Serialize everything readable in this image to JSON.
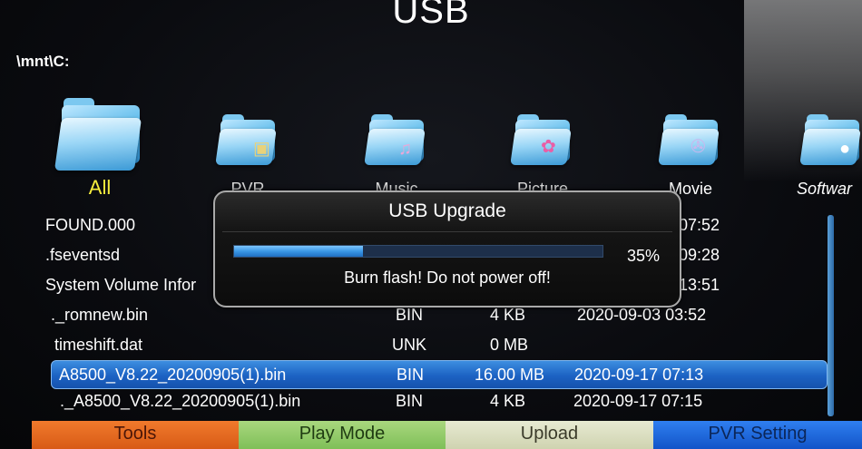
{
  "header": {
    "title": "USB",
    "path": "\\mnt\\C:"
  },
  "categories": [
    {
      "label": "All",
      "icon": "folder-icon",
      "active": true
    },
    {
      "label": "PVR",
      "icon": "pvr-folder-icon"
    },
    {
      "label": "Music",
      "icon": "music-folder-icon"
    },
    {
      "label": "Picture",
      "icon": "picture-folder-icon"
    },
    {
      "label": "Movie",
      "icon": "movie-folder-icon"
    },
    {
      "label": "Softwar",
      "icon": "software-folder-icon"
    }
  ],
  "files": [
    {
      "name": "FOUND.000",
      "type": "",
      "size": "",
      "date": "07:52"
    },
    {
      "name": ".fseventsd",
      "type": "",
      "size": "",
      "date": "09:28"
    },
    {
      "name": "System Volume Infor",
      "type": "",
      "size": "",
      "date": "13:51"
    },
    {
      "name": "._romnew.bin",
      "type": "BIN",
      "size": "4 KB",
      "date": "2020-09-03 03:52"
    },
    {
      "name": "timeshift.dat",
      "type": "UNK",
      "size": "0 MB",
      "date": ""
    },
    {
      "name": "A8500_V8.22_20200905(1).bin",
      "type": "BIN",
      "size": "16.00 MB",
      "date": "2020-09-17 07:13",
      "selected": true
    },
    {
      "name": "._A8500_V8.22_20200905(1).bin",
      "type": "BIN",
      "size": "4 KB",
      "date": "2020-09-17 07:15"
    }
  ],
  "dialog": {
    "title": "USB Upgrade",
    "progress": 0.35,
    "progress_label": "35%",
    "message": "Burn flash!  Do not power off!"
  },
  "bottom_bar": {
    "tools": "Tools",
    "play_mode": "Play Mode",
    "upload": "Upload",
    "pvr_setting": "PVR Setting"
  },
  "colors": {
    "selected_row": "#1c62c3",
    "active_category": "#f6ee3d",
    "tools": "#e46a20",
    "play_mode": "#94cb6b",
    "upload": "#dbdfc1",
    "pvr_setting": "#1f69dc"
  }
}
